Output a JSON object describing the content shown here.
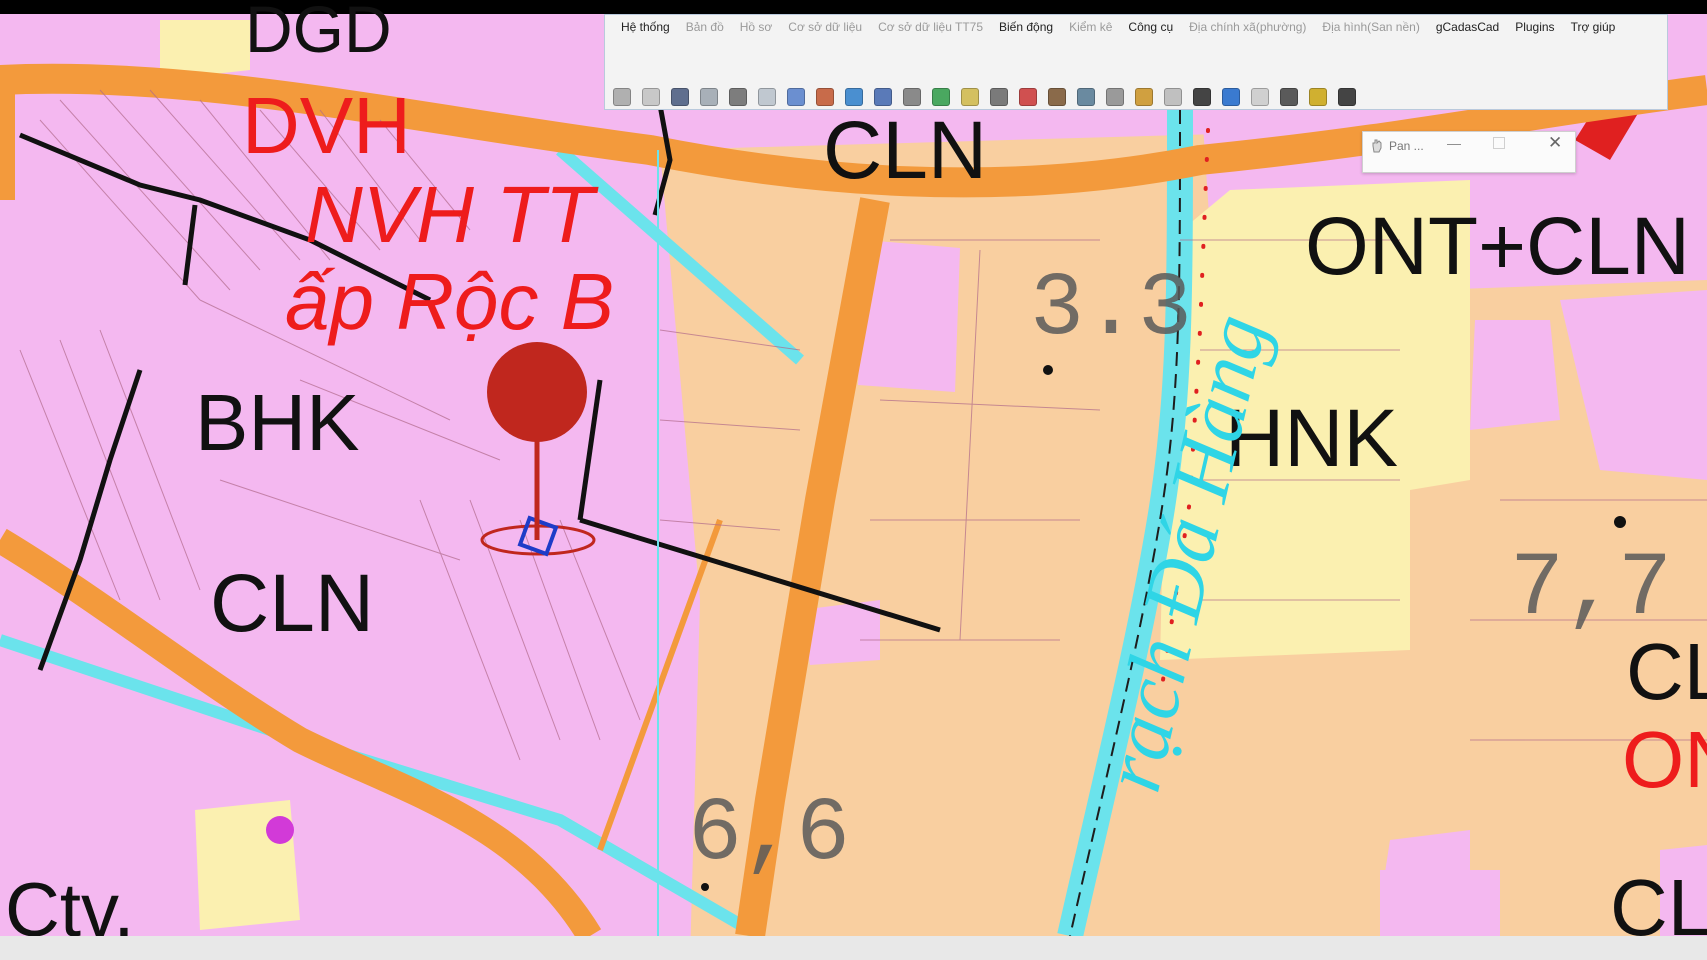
{
  "app": {
    "menu": [
      "Hệ thống",
      "Bản đồ",
      "Hồ sơ",
      "Cơ sở dữ liệu",
      "Cơ sở dữ liệu TT75",
      "Biến động",
      "Kiểm kê",
      "Công cụ",
      "Địa chính xã(phường)",
      "Địa hình(San nền)",
      "gCadasCad",
      "Plugins",
      "Trợ giúp"
    ],
    "menu_dim": [
      false,
      true,
      true,
      true,
      true,
      false,
      true,
      false,
      true,
      true,
      false,
      false,
      false
    ]
  },
  "pan_window": {
    "title": "Pan ...",
    "minimize": "—",
    "close": "✕"
  },
  "map": {
    "labels": {
      "dgd": "DGD",
      "dvh": "DVH",
      "nvh": "NVH TT",
      "ap_roc_b": "ấp Rộc B",
      "cln_top": "CLN",
      "ont_cln": "ONT+CLN",
      "bhk": "BHK",
      "hnk": "HNK",
      "cln_left": "CLN",
      "ctv": "Ctv.",
      "cl_right1": "CL",
      "on_right": "ON",
      "cl_right2": "CL",
      "canal": "rạch Đá Hàng",
      "num_33": "3.3",
      "num_77": "7,7",
      "num_66": "6,6"
    }
  },
  "colors": {
    "residential": "#f4b8f0",
    "perennial": "#f9cfa0",
    "road": "#f39a3c",
    "annual_crop": "#fbf0b0",
    "water": "#6be3ec",
    "marker": "#c0271e",
    "label_red": "#ee1c1c"
  }
}
